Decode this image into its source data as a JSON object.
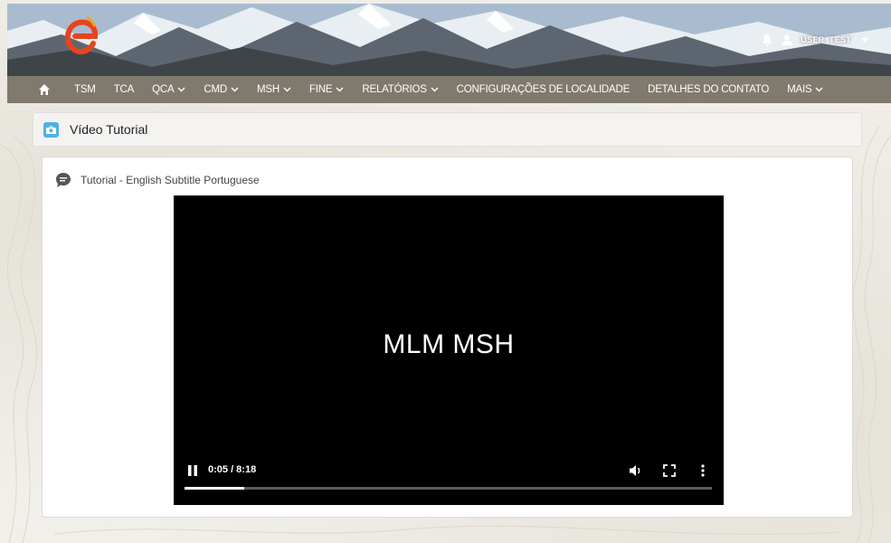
{
  "header": {
    "user_name": "USER_TEST"
  },
  "nav": {
    "items": [
      {
        "label": "TSM",
        "dropdown": false
      },
      {
        "label": "TCA",
        "dropdown": false
      },
      {
        "label": "QCA",
        "dropdown": true
      },
      {
        "label": "CMD",
        "dropdown": true
      },
      {
        "label": "MSH",
        "dropdown": true
      },
      {
        "label": "FINE",
        "dropdown": true
      },
      {
        "label": "RELATÓRIOS",
        "dropdown": true
      },
      {
        "label": "CONFIGURAÇÕES DE LOCALIDADE",
        "dropdown": false
      },
      {
        "label": "DETALHES DO CONTATO",
        "dropdown": false
      },
      {
        "label": "MAIS",
        "dropdown": true
      }
    ]
  },
  "page": {
    "title": "Vídeo Tutorial"
  },
  "card": {
    "title": "Tutorial - English Subtitle Portuguese"
  },
  "video": {
    "title": "MLM MSH",
    "time": "0:05 / 8:18",
    "progress": 0.113
  },
  "colors": {
    "brand": "#e8431e",
    "accent": "#4eb1e6",
    "navbar": "#767064"
  },
  "icons": {
    "home": "home-icon",
    "bell": "bell-icon",
    "user": "user-icon",
    "camera": "camera-icon",
    "chat": "chat-icon"
  }
}
